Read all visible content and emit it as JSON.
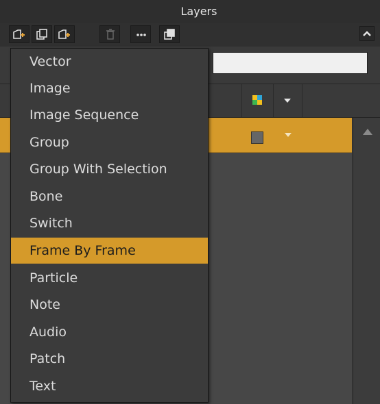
{
  "panel": {
    "title": "Layers"
  },
  "toolbar": {
    "buttons": [
      {
        "name": "new-layer-icon"
      },
      {
        "name": "duplicate-layer-icon"
      },
      {
        "name": "new-group-icon"
      },
      {
        "name": "trash-icon"
      },
      {
        "name": "more-options-icon"
      },
      {
        "name": "copy-layer-icon"
      }
    ],
    "collapse_icon": "chevron-up-icon"
  },
  "menu": {
    "items": [
      {
        "label": "Vector"
      },
      {
        "label": "Image"
      },
      {
        "label": "Image Sequence"
      },
      {
        "label": "Group"
      },
      {
        "label": "Group With Selection"
      },
      {
        "label": "Bone"
      },
      {
        "label": "Switch"
      },
      {
        "label": "Frame By Frame",
        "selected": true
      },
      {
        "label": "Particle"
      },
      {
        "label": "Note"
      },
      {
        "label": "Audio"
      },
      {
        "label": "Patch"
      },
      {
        "label": "Text"
      }
    ]
  },
  "colors": {
    "selected": "#d59a2a",
    "panel": "#3a3a3a",
    "menu": "#3b3b3b"
  }
}
